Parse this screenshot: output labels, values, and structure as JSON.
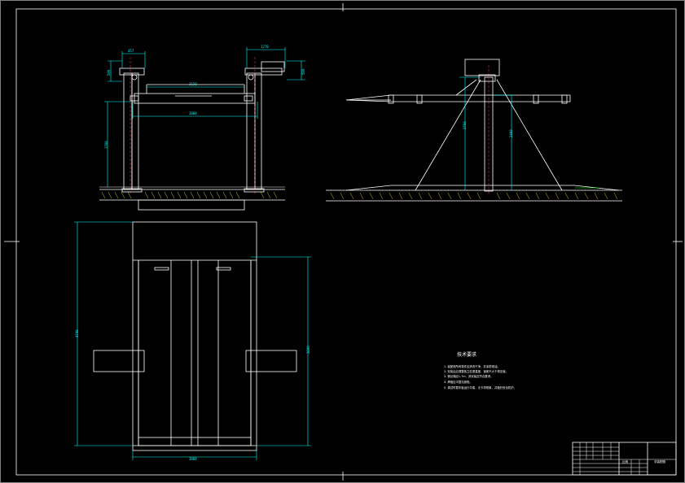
{
  "drawing": {
    "colors": {
      "background": "#000000",
      "outline": "#ffffff",
      "dimension": "#00ffff",
      "centerline": "#ff4040",
      "ground_hatch": "#d8c400",
      "frame_accent": "#00ff00"
    },
    "front_view": {
      "dims": {
        "top_left": "457",
        "top_right": "1270",
        "left_side": "580",
        "right_side": "580",
        "inner_span": "3150",
        "beam_width": "3884",
        "height": "1700"
      }
    },
    "side_view": {
      "dims": {
        "post_height": "2700",
        "beam_height": "2400"
      }
    },
    "plan_view": {
      "dims": {
        "overall_length": "4740",
        "platform_length": "3600",
        "bottom_width": "3884"
      }
    },
    "notes": {
      "title": "技术要求",
      "items": [
        "1. 装配前所有零件应清洗干净，并涂防锈油。",
        "2. 安装后应调整各立柱垂直度，误差不大于规定值。",
        "3. 钢丝绳应1.7m，其安装应符合要求。",
        "4. 焊缝应平整无缺陷。",
        "5. 调试时载车板运行平稳，无卡滞现象，并做好安全防护。"
      ]
    },
    "title_block": {
      "drawing_title": "总装配图",
      "code": "比例"
    }
  }
}
